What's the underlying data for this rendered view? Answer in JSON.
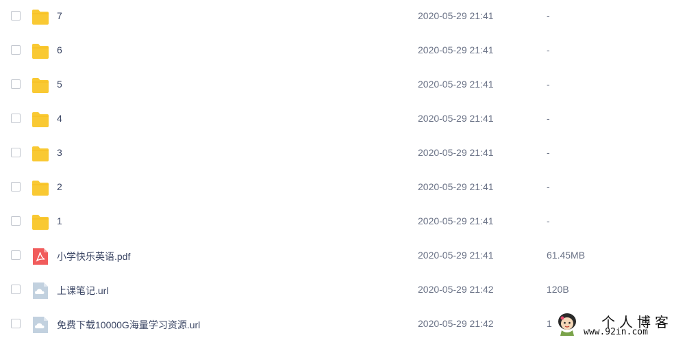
{
  "files": [
    {
      "name": "7",
      "date": "2020-05-29 21:41",
      "size": "-",
      "type": "folder",
      "icon": "folder-icon"
    },
    {
      "name": "6",
      "date": "2020-05-29 21:41",
      "size": "-",
      "type": "folder",
      "icon": "folder-icon"
    },
    {
      "name": "5",
      "date": "2020-05-29 21:41",
      "size": "-",
      "type": "folder",
      "icon": "folder-icon"
    },
    {
      "name": "4",
      "date": "2020-05-29 21:41",
      "size": "-",
      "type": "folder",
      "icon": "folder-icon"
    },
    {
      "name": "3",
      "date": "2020-05-29 21:41",
      "size": "-",
      "type": "folder",
      "icon": "folder-icon"
    },
    {
      "name": "2",
      "date": "2020-05-29 21:41",
      "size": "-",
      "type": "folder",
      "icon": "folder-icon"
    },
    {
      "name": "1",
      "date": "2020-05-29 21:41",
      "size": "-",
      "type": "folder",
      "icon": "folder-icon"
    },
    {
      "name": "小学快乐英语.pdf",
      "date": "2020-05-29 21:41",
      "size": "61.45MB",
      "type": "pdf",
      "icon": "pdf-file-icon"
    },
    {
      "name": "上课笔记.url",
      "date": "2020-05-29 21:42",
      "size": "120B",
      "type": "url",
      "icon": "url-file-icon"
    },
    {
      "name": "免费下载10000G海量学习资源.url",
      "date": "2020-05-29 21:42",
      "size": "1",
      "type": "url",
      "icon": "url-file-icon"
    }
  ],
  "watermark": {
    "title": "个人博客",
    "url": "www.92in.com"
  },
  "colors": {
    "folder": "#f9c933",
    "pdf": "#f15c5c",
    "url_file": "#c2d1df"
  }
}
